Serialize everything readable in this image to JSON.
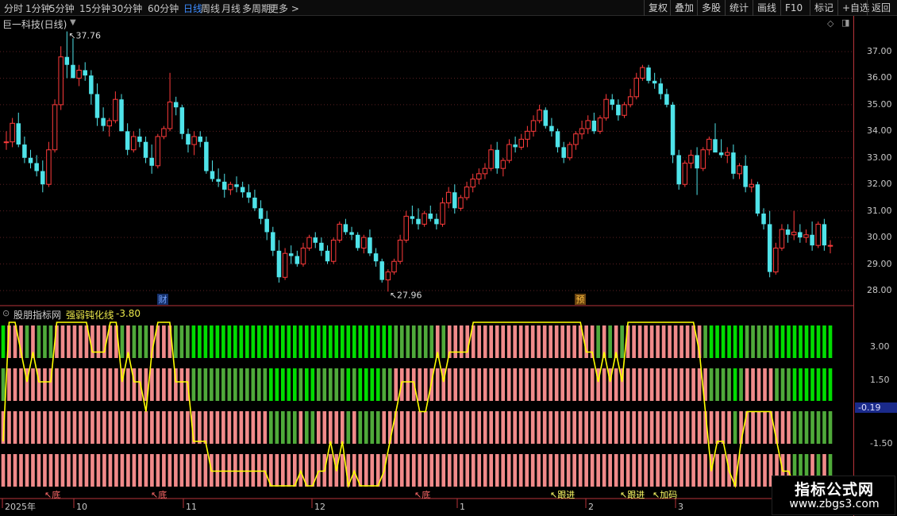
{
  "toolbar": {
    "timeframes": [
      "分时",
      "1分钟",
      "5分钟",
      "15分钟",
      "30分钟",
      "60分钟",
      "日线",
      "周线",
      "月线",
      "多周期",
      "更多 >"
    ],
    "active_timeframe": "日线",
    "right_tools": [
      "复权",
      "叠加",
      "多股",
      "统计",
      "画线",
      "F10",
      "标记",
      "+自选",
      "返回"
    ]
  },
  "main_chart": {
    "title": "巨一科技(日线)",
    "high_label": "37.76",
    "low_label": "27.96",
    "event_markers": [
      "财",
      "预"
    ],
    "price_ticks": [
      "37.00",
      "36.00",
      "35.00",
      "34.00",
      "33.00",
      "32.00",
      "31.00",
      "30.00",
      "29.00",
      "28.00"
    ]
  },
  "indicator": {
    "source": "股朋指标网",
    "name": "强弱钝化线",
    "value": "-3.80",
    "ticks": [
      "3.00",
      "1.50",
      "-1.50"
    ],
    "current_value": "-0.19",
    "signals": [
      "底",
      "底",
      "底",
      "跟进",
      "跟进",
      "加码"
    ]
  },
  "time_axis": {
    "labels": [
      "2025年",
      "10",
      "11",
      "12",
      "1",
      "2",
      "3"
    ]
  },
  "watermark": {
    "title": "指标公式网",
    "url": "www.zbgs3.com"
  },
  "colors": {
    "up": "#ff3b3b",
    "down": "#4fe3e9",
    "yellow_line": "#ffff00",
    "pink_bar": "#f08a8a",
    "green_bar": "#4faa3a",
    "bright_green_bar": "#00dd00"
  },
  "chart_data": {
    "type": "candlestick",
    "title": "巨一科技(日线)",
    "ylim": [
      27.7,
      37.9
    ],
    "x": [
      "2025-09",
      "2025-10",
      "2025-11",
      "2025-12",
      "2026-01",
      "2026-02",
      "2026-03"
    ],
    "candles": [
      [
        33.6,
        34.0,
        33.3,
        33.6
      ],
      [
        33.6,
        34.5,
        33.4,
        34.3
      ],
      [
        34.3,
        34.7,
        33.4,
        33.5
      ],
      [
        33.5,
        33.8,
        32.8,
        33.0
      ],
      [
        33.0,
        33.3,
        32.6,
        32.8
      ],
      [
        32.8,
        33.1,
        32.3,
        32.5
      ],
      [
        32.5,
        32.9,
        31.7,
        32.0
      ],
      [
        32.0,
        33.6,
        31.9,
        33.3
      ],
      [
        33.3,
        35.2,
        33.2,
        35.0
      ],
      [
        35.0,
        37.2,
        34.8,
        36.8
      ],
      [
        36.8,
        37.76,
        36.0,
        36.5
      ],
      [
        36.5,
        37.5,
        36.0,
        36.0
      ],
      [
        36.0,
        36.5,
        35.7,
        36.3
      ],
      [
        36.3,
        36.6,
        35.9,
        36.1
      ],
      [
        36.1,
        36.3,
        35.0,
        35.4
      ],
      [
        35.4,
        35.8,
        34.2,
        34.5
      ],
      [
        34.5,
        34.9,
        34.0,
        34.2
      ],
      [
        34.2,
        34.5,
        33.8,
        34.4
      ],
      [
        34.4,
        35.5,
        34.3,
        35.2
      ],
      [
        35.2,
        35.4,
        34.1,
        34.0
      ],
      [
        34.0,
        34.3,
        33.1,
        33.3
      ],
      [
        33.3,
        34.0,
        33.2,
        33.8
      ],
      [
        33.8,
        34.1,
        33.4,
        33.6
      ],
      [
        33.6,
        33.8,
        32.8,
        33.0
      ],
      [
        33.0,
        33.5,
        32.4,
        32.7
      ],
      [
        32.7,
        33.9,
        32.6,
        33.8
      ],
      [
        33.8,
        34.2,
        33.7,
        34.1
      ],
      [
        34.1,
        36.2,
        34.0,
        35.1
      ],
      [
        35.1,
        35.3,
        34.6,
        34.9
      ],
      [
        34.9,
        35.0,
        33.7,
        33.9
      ],
      [
        33.9,
        34.1,
        33.2,
        33.5
      ],
      [
        33.5,
        34.0,
        33.1,
        33.8
      ],
      [
        33.8,
        34.0,
        33.4,
        33.6
      ],
      [
        33.6,
        33.8,
        32.4,
        32.5
      ],
      [
        32.5,
        32.9,
        32.1,
        32.2
      ],
      [
        32.2,
        32.6,
        31.9,
        32.1
      ],
      [
        32.1,
        32.4,
        31.5,
        31.8
      ],
      [
        31.8,
        32.1,
        31.6,
        32.0
      ],
      [
        32.0,
        32.3,
        31.7,
        31.9
      ],
      [
        31.9,
        32.1,
        31.5,
        31.7
      ],
      [
        31.7,
        32.0,
        31.3,
        31.5
      ],
      [
        31.5,
        31.8,
        31.0,
        31.1
      ],
      [
        31.1,
        31.4,
        30.5,
        30.7
      ],
      [
        30.7,
        31.0,
        29.9,
        30.2
      ],
      [
        30.2,
        30.4,
        29.3,
        29.5
      ],
      [
        29.5,
        29.9,
        28.3,
        28.5
      ],
      [
        28.5,
        29.6,
        28.4,
        29.4
      ],
      [
        29.4,
        29.7,
        29.0,
        29.3
      ],
      [
        29.3,
        29.5,
        28.9,
        29.0
      ],
      [
        29.0,
        29.8,
        28.9,
        29.6
      ],
      [
        29.6,
        30.1,
        29.5,
        30.0
      ],
      [
        30.0,
        30.2,
        29.6,
        29.8
      ],
      [
        29.8,
        30.0,
        29.3,
        29.5
      ],
      [
        29.5,
        29.7,
        29.0,
        29.1
      ],
      [
        29.1,
        30.0,
        29.0,
        29.9
      ],
      [
        29.9,
        30.6,
        29.8,
        30.5
      ],
      [
        30.5,
        30.7,
        30.1,
        30.2
      ],
      [
        30.2,
        30.4,
        29.9,
        30.1
      ],
      [
        30.1,
        30.2,
        29.5,
        29.6
      ],
      [
        29.6,
        30.1,
        29.4,
        30.0
      ],
      [
        30.0,
        30.3,
        29.3,
        29.4
      ],
      [
        29.4,
        29.6,
        28.9,
        29.1
      ],
      [
        29.1,
        29.2,
        28.3,
        28.4
      ],
      [
        28.4,
        28.8,
        27.96,
        28.7
      ],
      [
        28.7,
        29.2,
        28.6,
        29.1
      ],
      [
        29.1,
        30.1,
        29.0,
        29.9
      ],
      [
        29.9,
        31.0,
        29.8,
        30.8
      ],
      [
        30.8,
        31.2,
        30.5,
        30.7
      ],
      [
        30.7,
        31.1,
        30.3,
        30.5
      ],
      [
        30.5,
        31.0,
        30.4,
        30.9
      ],
      [
        30.9,
        31.2,
        30.6,
        30.7
      ],
      [
        30.7,
        30.9,
        30.3,
        30.5
      ],
      [
        30.5,
        31.5,
        30.4,
        31.3
      ],
      [
        31.3,
        31.9,
        31.1,
        31.7
      ],
      [
        31.7,
        32.0,
        30.9,
        31.1
      ],
      [
        31.1,
        31.6,
        31.0,
        31.5
      ],
      [
        31.5,
        32.1,
        31.4,
        31.9
      ],
      [
        31.9,
        32.4,
        31.7,
        32.2
      ],
      [
        32.2,
        32.6,
        32.0,
        32.4
      ],
      [
        32.4,
        32.8,
        32.2,
        32.6
      ],
      [
        32.6,
        33.5,
        32.5,
        33.3
      ],
      [
        33.3,
        33.6,
        32.4,
        32.6
      ],
      [
        32.6,
        33.0,
        32.3,
        32.9
      ],
      [
        32.9,
        33.7,
        32.8,
        33.5
      ],
      [
        33.5,
        33.8,
        33.2,
        33.4
      ],
      [
        33.4,
        33.9,
        33.3,
        33.7
      ],
      [
        33.7,
        34.2,
        33.4,
        34.0
      ],
      [
        34.0,
        34.6,
        33.8,
        34.4
      ],
      [
        34.4,
        35.0,
        34.3,
        34.8
      ],
      [
        34.8,
        34.9,
        34.1,
        34.2
      ],
      [
        34.2,
        34.5,
        33.8,
        34.0
      ],
      [
        34.0,
        34.1,
        33.2,
        33.4
      ],
      [
        33.4,
        33.6,
        32.8,
        33.0
      ],
      [
        33.0,
        33.6,
        32.9,
        33.5
      ],
      [
        33.5,
        34.0,
        33.3,
        33.9
      ],
      [
        33.9,
        34.4,
        33.7,
        34.1
      ],
      [
        34.1,
        34.6,
        33.9,
        34.4
      ],
      [
        34.4,
        34.7,
        33.9,
        34.0
      ],
      [
        34.0,
        34.6,
        33.9,
        34.5
      ],
      [
        34.5,
        35.4,
        34.4,
        35.2
      ],
      [
        35.2,
        35.4,
        34.8,
        35.0
      ],
      [
        35.0,
        35.2,
        34.4,
        34.6
      ],
      [
        34.6,
        35.1,
        34.5,
        35.0
      ],
      [
        35.0,
        35.6,
        34.9,
        35.3
      ],
      [
        35.3,
        36.2,
        35.2,
        36.0
      ],
      [
        36.0,
        36.5,
        35.9,
        36.4
      ],
      [
        36.4,
        36.5,
        35.8,
        35.9
      ],
      [
        35.9,
        36.2,
        35.6,
        35.8
      ],
      [
        35.8,
        36.0,
        35.2,
        35.4
      ],
      [
        35.4,
        35.6,
        34.9,
        35.0
      ],
      [
        35.0,
        35.1,
        32.8,
        33.1
      ],
      [
        33.1,
        33.3,
        31.8,
        32.0
      ],
      [
        32.0,
        32.9,
        31.9,
        32.8
      ],
      [
        32.8,
        33.3,
        32.6,
        33.1
      ],
      [
        33.1,
        33.4,
        31.6,
        32.6
      ],
      [
        32.6,
        33.4,
        32.5,
        33.3
      ],
      [
        33.3,
        33.8,
        33.1,
        33.7
      ],
      [
        33.7,
        34.3,
        33.5,
        33.2
      ],
      [
        33.2,
        33.7,
        33.0,
        33.1
      ],
      [
        33.1,
        33.4,
        32.8,
        33.2
      ],
      [
        33.2,
        33.5,
        32.2,
        32.4
      ],
      [
        32.4,
        32.8,
        32.2,
        32.7
      ],
      [
        32.7,
        33.1,
        31.7,
        31.9
      ],
      [
        31.9,
        32.2,
        31.7,
        32.0
      ],
      [
        32.0,
        32.1,
        30.8,
        30.9
      ],
      [
        30.9,
        31.1,
        30.3,
        30.5
      ],
      [
        30.5,
        31.0,
        28.5,
        28.7
      ],
      [
        28.7,
        29.8,
        28.6,
        29.6
      ],
      [
        29.6,
        30.5,
        29.5,
        30.3
      ],
      [
        30.3,
        30.5,
        29.8,
        30.1
      ],
      [
        30.1,
        31.0,
        29.9,
        30.2
      ],
      [
        30.2,
        30.5,
        29.8,
        30.0
      ],
      [
        30.0,
        30.3,
        29.8,
        30.1
      ],
      [
        30.1,
        30.6,
        29.5,
        29.7
      ],
      [
        29.7,
        30.6,
        29.6,
        30.5
      ],
      [
        30.5,
        30.7,
        29.5,
        29.7
      ],
      [
        29.7,
        29.9,
        29.4,
        29.7
      ]
    ],
    "indicator_series": {
      "name": "强弱钝化线",
      "value": -3.8,
      "current": -0.19,
      "levels": [
        0,
        4,
        4,
        3,
        2,
        3,
        2,
        2,
        2,
        4,
        4,
        4,
        4,
        4,
        4,
        3,
        3,
        3,
        4,
        4,
        2,
        3,
        2,
        2,
        1,
        3,
        4,
        4,
        4,
        2,
        2,
        2,
        0,
        0,
        0,
        -1,
        -1,
        -1,
        -1,
        -1,
        -1,
        -1,
        -1,
        -1,
        -1,
        -2,
        -2,
        -2,
        -2,
        -2,
        -1,
        -2,
        -2,
        -1,
        -1,
        0,
        -1,
        0,
        -2,
        -1,
        -2,
        -2,
        -2,
        -2,
        -1,
        0,
        1,
        2,
        2,
        2,
        1,
        1,
        2,
        3,
        2,
        3,
        3,
        3,
        3,
        4,
        4,
        4,
        4,
        4,
        4,
        4,
        4,
        4,
        4,
        4,
        4,
        4,
        4,
        4,
        4,
        4,
        4,
        4,
        3,
        3,
        2,
        3,
        2,
        3,
        2,
        4,
        4,
        4,
        4,
        4,
        4,
        4,
        4,
        4,
        4,
        4,
        4,
        3,
        1,
        -1,
        0,
        0,
        -1,
        -2,
        0,
        1,
        1,
        1,
        1,
        1,
        0,
        -1,
        -1,
        -3,
        -3,
        -3,
        -2,
        -3,
        -2,
        -3
      ]
    }
  }
}
